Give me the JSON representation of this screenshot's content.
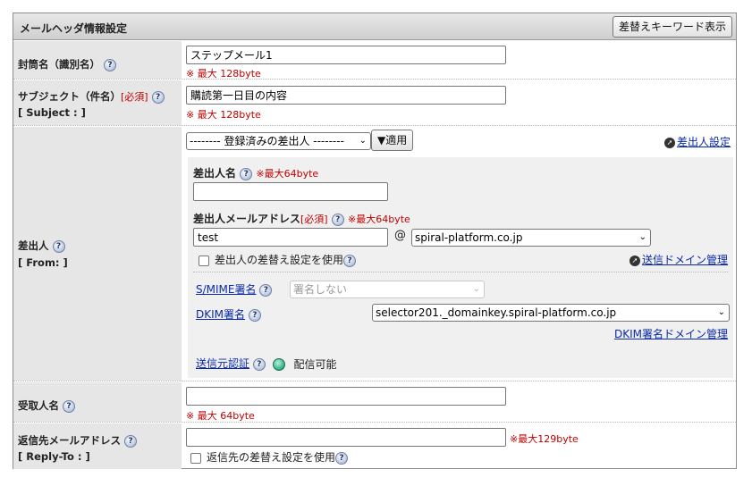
{
  "header": {
    "title": "メールヘッダ情報設定",
    "keyword_button": "差替えキーワード表示"
  },
  "name_row": {
    "label": "封筒名（識別名）",
    "value": "ステップメール1",
    "note": "※ 最大 128byte"
  },
  "subject_row": {
    "label": "サブジェクト（件名）",
    "required": "[必須]",
    "sublabel": "[ Subject : ]",
    "value": "購読第一日目の内容",
    "note": "※ 最大 128byte"
  },
  "from_row": {
    "label": "差出人",
    "sublabel": "[ From: ]",
    "sender_select": "-------- 登録済みの差出人 --------",
    "apply_button": "▼適用",
    "sender_settings_link": "差出人設定",
    "name_label": "差出人名",
    "name_note": "※最大64byte",
    "name_value": "",
    "address_label": "差出人メールアドレス",
    "address_required": "[必須]",
    "address_note": "※最大64byte",
    "address_local": "test",
    "at_sign": "@",
    "address_domain": "spiral-platform.co.jp",
    "replace_checkbox_label": "差出人の差替え設定を使用",
    "domain_manage_link": "送信ドメイン管理",
    "smime_link": "S/MIME署名",
    "smime_select": "署名しない",
    "dkim_link": "DKIM署名",
    "dkim_select": "selector201._domainkey.spiral-platform.co.jp",
    "dkim_domain_link": "DKIM署名ドメイン管理",
    "auth_link": "送信元認証",
    "auth_status": "配信可能"
  },
  "recipient_row": {
    "label": "受取人名",
    "value": "",
    "note": "※ 最大 64byte"
  },
  "replyto_row": {
    "label": "返信先メールアドレス",
    "sublabel": "[ Reply-To : ]",
    "value": "",
    "note": "※最大129byte",
    "checkbox_label": "返信先の差替え設定を使用"
  },
  "icons": {
    "help": "?",
    "external": "➚",
    "chevron": "⌄"
  },
  "colors": {
    "required_red": "#c00000",
    "link_blue": "#0a2aa8",
    "label_bg": "#e6e6e6",
    "status_green": "#2eaf86"
  }
}
